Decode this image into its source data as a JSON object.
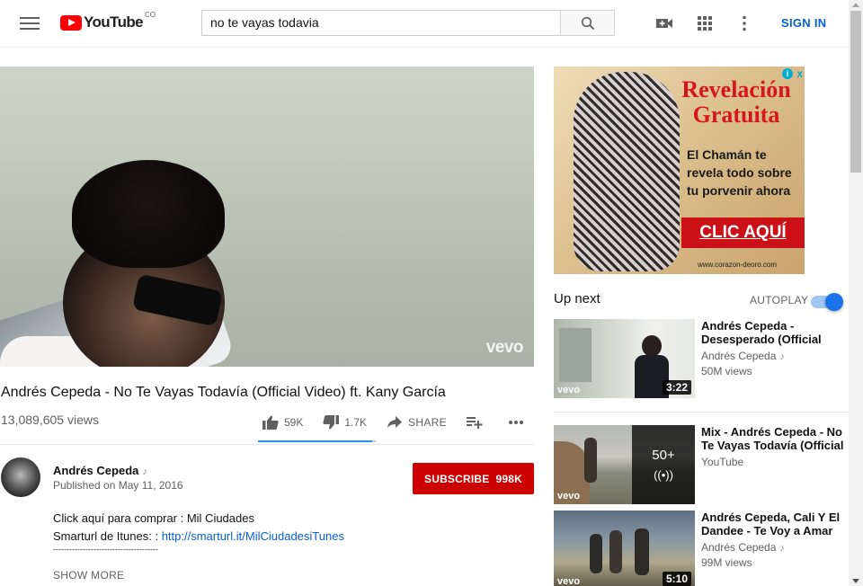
{
  "header": {
    "logo_text": "YouTube",
    "country_code": "CO",
    "search_value": "no te vayas todavia",
    "sign_in_label": "SIGN IN",
    "icons": [
      "menu-icon",
      "search-icon",
      "create-video-icon",
      "apps-icon",
      "more-icon"
    ]
  },
  "player": {
    "watermark": "vevo"
  },
  "video": {
    "title": "Andrés Cepeda - No Te Vayas Todavía (Official Video) ft. Kany García",
    "views": "13,089,605 views",
    "likes": "59K",
    "dislikes": "1.7K",
    "share_label": "SHARE",
    "like_ratio": 0.972
  },
  "channel": {
    "name": "Andrés Cepeda",
    "published": "Published on May 11, 2016",
    "subscribe_label": "SUBSCRIBE",
    "subscriber_count": "998K"
  },
  "description": {
    "line1": "Click aquí para comprar : Mil Ciudades",
    "line2_prefix": "Smarturl de Itunes:  :",
    "line2_link": "http://smarturl.it/MilCiudadesiTunes",
    "separator": "---------------------------------------",
    "show_more": "SHOW MORE"
  },
  "ad": {
    "title_line1": "Revelación",
    "title_line2": "Gratuita",
    "body": "El Chamán te revela todo sobre tu porvenir ahora",
    "cta": "CLIC AQUÍ",
    "url": "www.corazon-deoro.com",
    "info_icon": "i",
    "close_icon": "x"
  },
  "sidebar": {
    "up_next": "Up next",
    "autoplay_label": "AUTOPLAY",
    "autoplay_on": true,
    "recommendations": [
      {
        "title": "Andrés Cepeda - Desesperado (Official Video)",
        "channel": "Andrés Cepeda",
        "views": "50M views",
        "duration": "3:22",
        "badge": "vevo"
      },
      {
        "title": "Mix - Andrés Cepeda - No Te Vayas Todavía (Official Video)",
        "channel": "YouTube",
        "views": "",
        "mix_count": "50+",
        "badge": "vevo"
      },
      {
        "title": "Andrés Cepeda, Cali Y El Dandee - Te Voy a Amar",
        "channel": "Andrés Cepeda",
        "views": "99M views",
        "duration": "5:10",
        "badge": "vevo"
      }
    ]
  },
  "colors": {
    "brand_red": "#ff0000",
    "subscribe_red": "#cc0000",
    "link_blue": "#065fd4",
    "accent_blue": "#2793e6"
  }
}
